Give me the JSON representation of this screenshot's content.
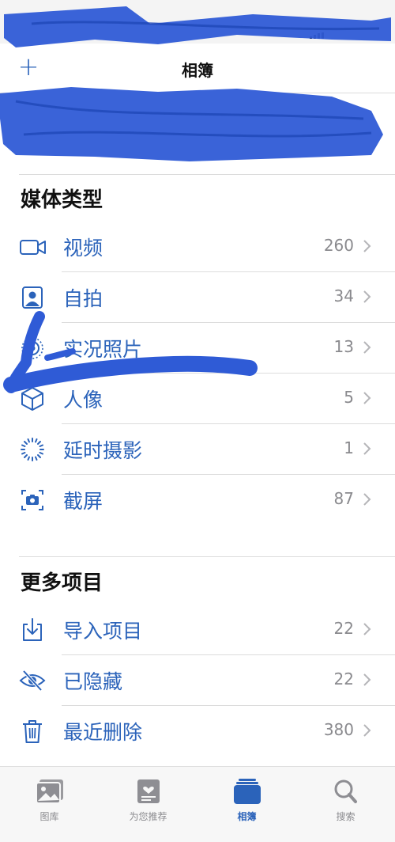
{
  "nav": {
    "title": "相簿",
    "add_label": "+"
  },
  "sections": {
    "media_types": {
      "header": "媒体类型",
      "items": [
        {
          "label": "视频",
          "count": "260",
          "icon": "video-icon"
        },
        {
          "label": "自拍",
          "count": "34",
          "icon": "selfie-icon"
        },
        {
          "label": "实况照片",
          "count": "13",
          "icon": "live-photo-icon"
        },
        {
          "label": "人像",
          "count": "5",
          "icon": "portrait-cube-icon"
        },
        {
          "label": "延时摄影",
          "count": "1",
          "icon": "timelapse-icon"
        },
        {
          "label": "截屏",
          "count": "87",
          "icon": "screenshot-icon"
        }
      ]
    },
    "more_items": {
      "header": "更多项目",
      "items": [
        {
          "label": "导入项目",
          "count": "22",
          "icon": "import-icon"
        },
        {
          "label": "已隐藏",
          "count": "22",
          "icon": "hidden-eye-icon"
        },
        {
          "label": "最近删除",
          "count": "380",
          "icon": "trash-icon"
        }
      ]
    }
  },
  "tab_bar": {
    "tabs": [
      {
        "label": "图库",
        "icon": "library-icon"
      },
      {
        "label": "为您推荐",
        "icon": "for-you-icon"
      },
      {
        "label": "相簿",
        "icon": "albums-icon",
        "active": true
      },
      {
        "label": "搜索",
        "icon": "search-icon"
      }
    ]
  },
  "colors": {
    "accent": "#2b63ba",
    "count_gray": "#8a8a8e",
    "scribble": "#2f5bd6"
  }
}
